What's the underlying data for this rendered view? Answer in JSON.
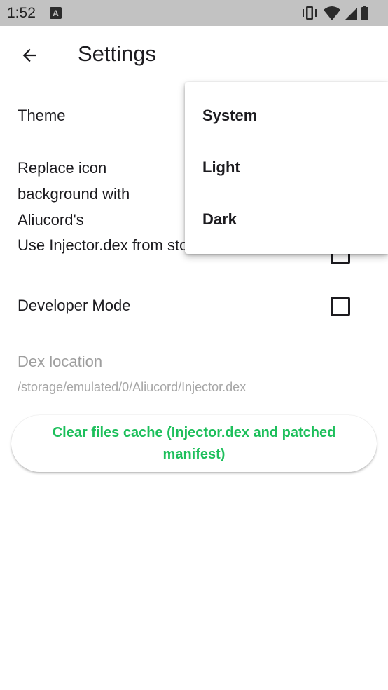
{
  "status_bar": {
    "time": "1:52",
    "notification_glyph": "A"
  },
  "app_bar": {
    "title": "Settings"
  },
  "settings": {
    "theme_label": "Theme",
    "replace_icon_label": "Replace icon background with Aliucord's",
    "injector_label": "Use Injector.dex from storage",
    "developer_mode_label": "Developer Mode",
    "developer_mode_checked": false,
    "dex_location_title": "Dex location",
    "dex_location_path": "/storage/emulated/0/Aliucord/Injector.dex"
  },
  "clear_cache_button": {
    "label": "Clear files cache (Injector.dex and patched manifest)",
    "color": "#1dbf5b"
  },
  "theme_dropdown": {
    "options": [
      "System",
      "Light",
      "Dark"
    ]
  },
  "icons": {
    "back": "arrow-left-icon",
    "vibrate": "vibrate-icon",
    "wifi": "wifi-icon",
    "signal": "signal-icon",
    "battery": "battery-icon"
  }
}
